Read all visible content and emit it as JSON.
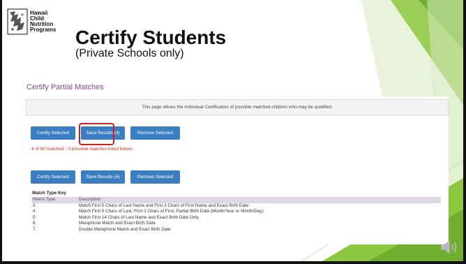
{
  "logo": {
    "lines": [
      "Hawaii",
      "Child",
      "Nutrition",
      "Programs"
    ]
  },
  "slide": {
    "title": "Certify Students",
    "subtitle": "(Private Schools only)"
  },
  "section": {
    "title": "Certify Partial Matches"
  },
  "info": {
    "text": "This page allows the Individual Certification of possible matched children who may be qualified."
  },
  "actions_top": {
    "certify": "Certify Selected",
    "save": "Save Results (4)",
    "remove": "Remove Selected"
  },
  "status": {
    "text": "4 of 60 matched - 0 possible matches listed below..."
  },
  "actions_bottom": {
    "certify": "Certify Selected",
    "save": "Save Results (4)",
    "remove": "Remove Selected"
  },
  "match_key": {
    "title": "Match Type Key",
    "headers": [
      "Match Type",
      "Description"
    ],
    "rows": [
      [
        "3",
        "Match First 5 Chars of Last Name and First 3 Chars of First Name and Exact Birth Date"
      ],
      [
        "4",
        "Match First 5 Chars of Last, First 3 Chars of First, Partial Birth Date (Month/Year or Month/Day)"
      ],
      [
        "5",
        "Match First 14 Chars of Last Name and Exact Birth Date Only"
      ],
      [
        "6",
        "Metaphone Match and Exact Birth Date"
      ],
      [
        "7",
        "Double Metaphone Match and Exact Birth Date"
      ]
    ]
  },
  "colors": {
    "button": "#3c7ec2",
    "highlight": "#cc1f1f",
    "accent_green": "#8dc63f",
    "section_title": "#7b4a8c"
  }
}
